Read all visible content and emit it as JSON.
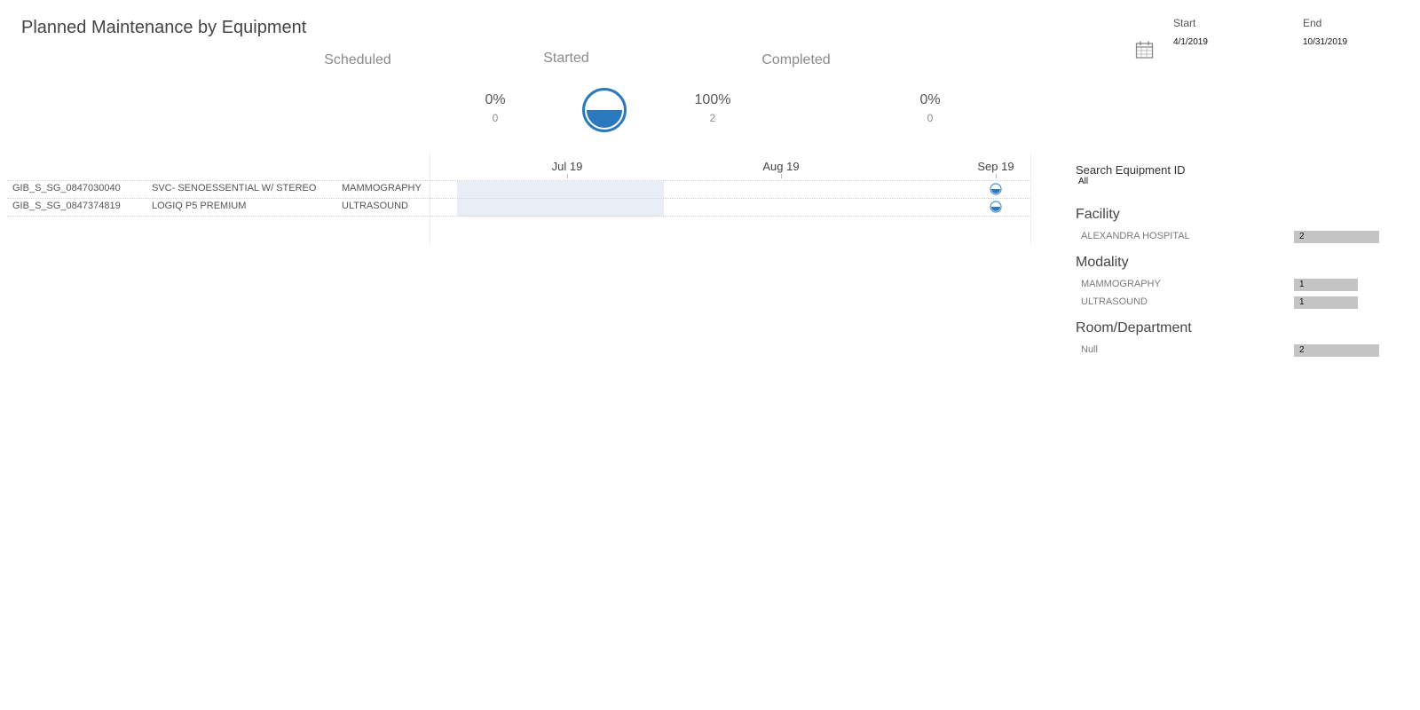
{
  "title": "Planned Maintenance by Equipment",
  "date_range": {
    "start_label": "Start",
    "start_value": "4/1/2019",
    "end_label": "End",
    "end_value": "10/31/2019"
  },
  "kpis": [
    {
      "label": "Scheduled",
      "percent": "0%",
      "count": "0"
    },
    {
      "label": "Started",
      "percent": "100%",
      "count": "2"
    },
    {
      "label": "Completed",
      "percent": "0%",
      "count": "0"
    }
  ],
  "equipment": [
    {
      "id": "GIB_S_SG_0847030040",
      "name": "SVC- SENOESSENTIAL W/ STEREO",
      "modality": "MAMMOGRAPHY"
    },
    {
      "id": "GIB_S_SG_0847374819",
      "name": "LOGIQ P5 PREMIUM",
      "modality": "ULTRASOUND"
    }
  ],
  "timeline": {
    "months": [
      "Jul 19",
      "Aug 19",
      "Sep 19"
    ]
  },
  "filters": {
    "search_label": "Search Equipment ID",
    "search_value": "All",
    "facility": {
      "title": "Facility",
      "items": [
        {
          "label": "ALEXANDRA HOSPITAL",
          "count": "2"
        }
      ]
    },
    "modality": {
      "title": "Modality",
      "items": [
        {
          "label": "MAMMOGRAPHY",
          "count": "1"
        },
        {
          "label": "ULTRASOUND",
          "count": "1"
        }
      ]
    },
    "room": {
      "title": "Room/Department",
      "items": [
        {
          "label": "Null",
          "count": "2"
        }
      ]
    }
  },
  "colors": {
    "status_blue": "#2a78bd",
    "marker_blue": "#4a8fd6",
    "bar_gray": "#c4c4c4",
    "shade": "#e9edf6"
  },
  "icons": [
    "calendar-icon",
    "half-filled-circle-icon",
    "status-marker-icon"
  ]
}
